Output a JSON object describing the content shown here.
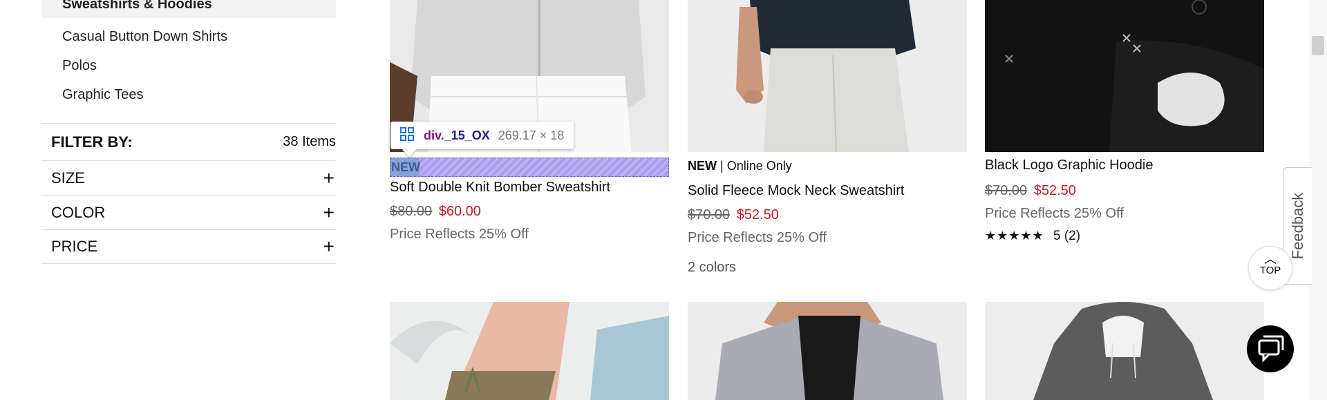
{
  "sidebar": {
    "categories": [
      {
        "label": "Sweatshirts & Hoodies",
        "active": true
      },
      {
        "label": "Casual Button Down Shirts"
      },
      {
        "label": "Polos"
      },
      {
        "label": "Graphic Tees"
      }
    ],
    "filter_title": "FILTER BY:",
    "item_count": "38 Items",
    "facets": [
      {
        "label": "SIZE",
        "icon": "plus-icon"
      },
      {
        "label": "COLOR",
        "icon": "plus-icon"
      },
      {
        "label": "PRICE",
        "icon": "plus-icon"
      }
    ]
  },
  "devtools": {
    "tag": "div.",
    "class": "_15_OX",
    "dims": "269.17 × 18",
    "highlight_text": "NEW"
  },
  "products": [
    {
      "name": "Soft Double Knit Bomber Sweatshirt",
      "orig_price": "$80.00",
      "sale_price": "$60.00",
      "note": "Price Reflects 25% Off"
    },
    {
      "badge_new": "NEW",
      "badge_sep": "|",
      "badge_extra": "Online Only",
      "name": "Solid Fleece Mock Neck Sweatshirt",
      "orig_price": "$70.00",
      "sale_price": "$52.50",
      "note": "Price Reflects 25% Off",
      "colors": "2 colors"
    },
    {
      "name": "Black Logo Graphic Hoodie",
      "orig_price": "$70.00",
      "sale_price": "$52.50",
      "note": "Price Reflects 25% Off",
      "stars": "★★★★★",
      "rating": "5",
      "reviews": "(2)"
    }
  ],
  "widgets": {
    "feedback_label": "Feedback",
    "top_label": "TOP"
  },
  "colors": {
    "sale": "#d3151d",
    "highlight": "#8c78e6"
  }
}
